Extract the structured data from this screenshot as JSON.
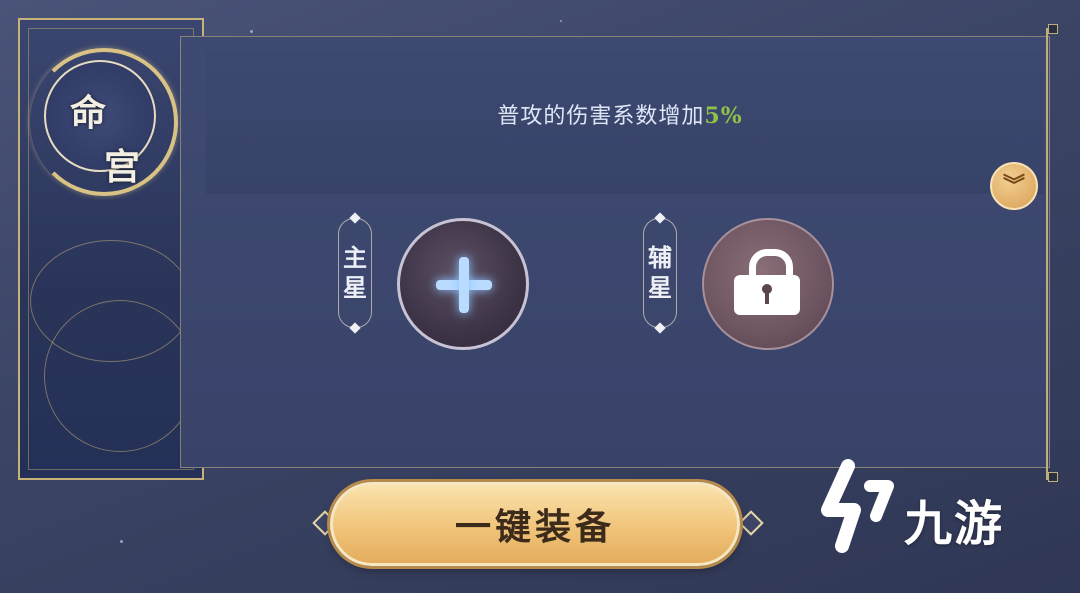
{
  "banner": {
    "title_char_1": "命",
    "title_char_2": "宫"
  },
  "effect": {
    "text": "普攻的伤害系数增加",
    "value": "5%",
    "value_color": "#8fc14a"
  },
  "expand_button": {
    "icon": "double-chevron-down-icon",
    "glyph": "︾"
  },
  "slots": {
    "main": {
      "label_1": "主",
      "label_2": "星",
      "icon": "plus-icon"
    },
    "aux": {
      "label_1": "辅",
      "label_2": "星",
      "icon": "lock-icon"
    }
  },
  "equip_button": {
    "label": "一键装备"
  },
  "watermark": {
    "text": "九游",
    "logo_icon": "jiuyou-logo-icon"
  },
  "colors": {
    "gold_accent": "#c8b27a",
    "button_gold": "#f0c47a",
    "panel_bg": "#3f4a72"
  }
}
